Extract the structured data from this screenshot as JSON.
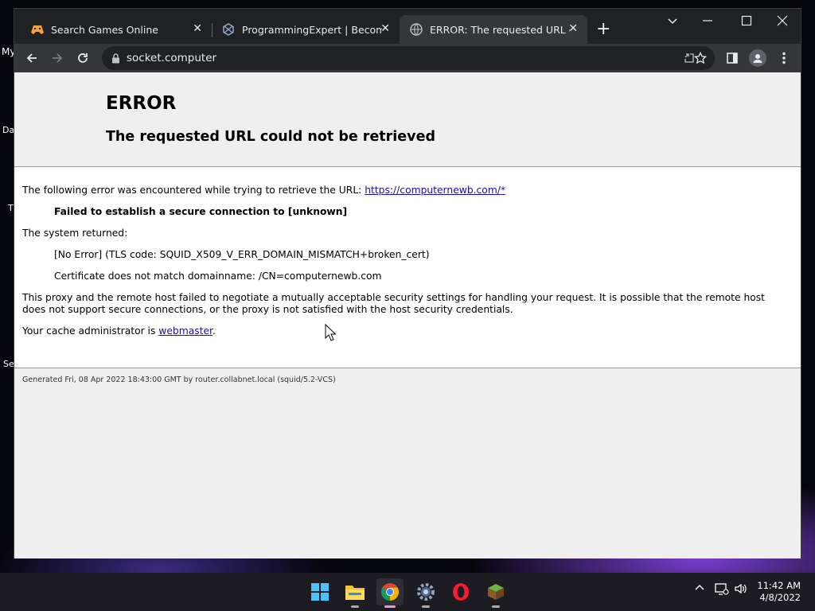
{
  "desktop": {
    "icon_labels": [
      "My",
      "Da",
      "T",
      "Se"
    ]
  },
  "browser": {
    "tabs": [
      {
        "title": "Search Games Online",
        "icon": "gamepad-icon"
      },
      {
        "title": "ProgrammingExpert | Become A",
        "icon": "programmingexpert-icon"
      },
      {
        "title": "ERROR: The requested URL could",
        "icon": "globe-icon",
        "active": true
      }
    ],
    "close_symbol": "✕",
    "new_tab_symbol": "+",
    "url": "socket.computer"
  },
  "page": {
    "heading": "ERROR",
    "subheading": "The requested URL could not be retrieved",
    "intro": "The following error was encountered while trying to retrieve the URL: ",
    "url_link": "https://computernewb.com/*",
    "failure": "Failed to establish a secure connection to [unknown]",
    "system_returned": "The system returned:",
    "error_code": "[No Error] (TLS code: SQUID_X509_V_ERR_DOMAIN_MISMATCH+broken_cert)",
    "cert_detail": "Certificate does not match domainname: /CN=computernewb.com",
    "explanation": "This proxy and the remote host failed to negotiate a mutually acceptable security settings for handling your request. It is possible that the remote host does not support secure connections, or the proxy is not satisfied with the host security credentials.",
    "admin_prefix": "Your cache administrator is ",
    "admin_link": "webmaster",
    "admin_suffix": ".",
    "generated": "Generated Fri, 08 Apr 2022 18:43:00 GMT by router.collabnet.local (squid/5.2-VCS)"
  },
  "taskbar": {
    "apps": [
      "start-icon",
      "file-explorer-icon",
      "chrome-icon",
      "settings-icon",
      "opera-icon",
      "minecraft-icon"
    ],
    "time": "11:42 AM",
    "date": "4/8/2022"
  },
  "colors": {
    "link": "#1a0dab",
    "header_bg": "#efefef",
    "chrome_dark": "#202124",
    "chrome_toolbar": "#35363a"
  }
}
